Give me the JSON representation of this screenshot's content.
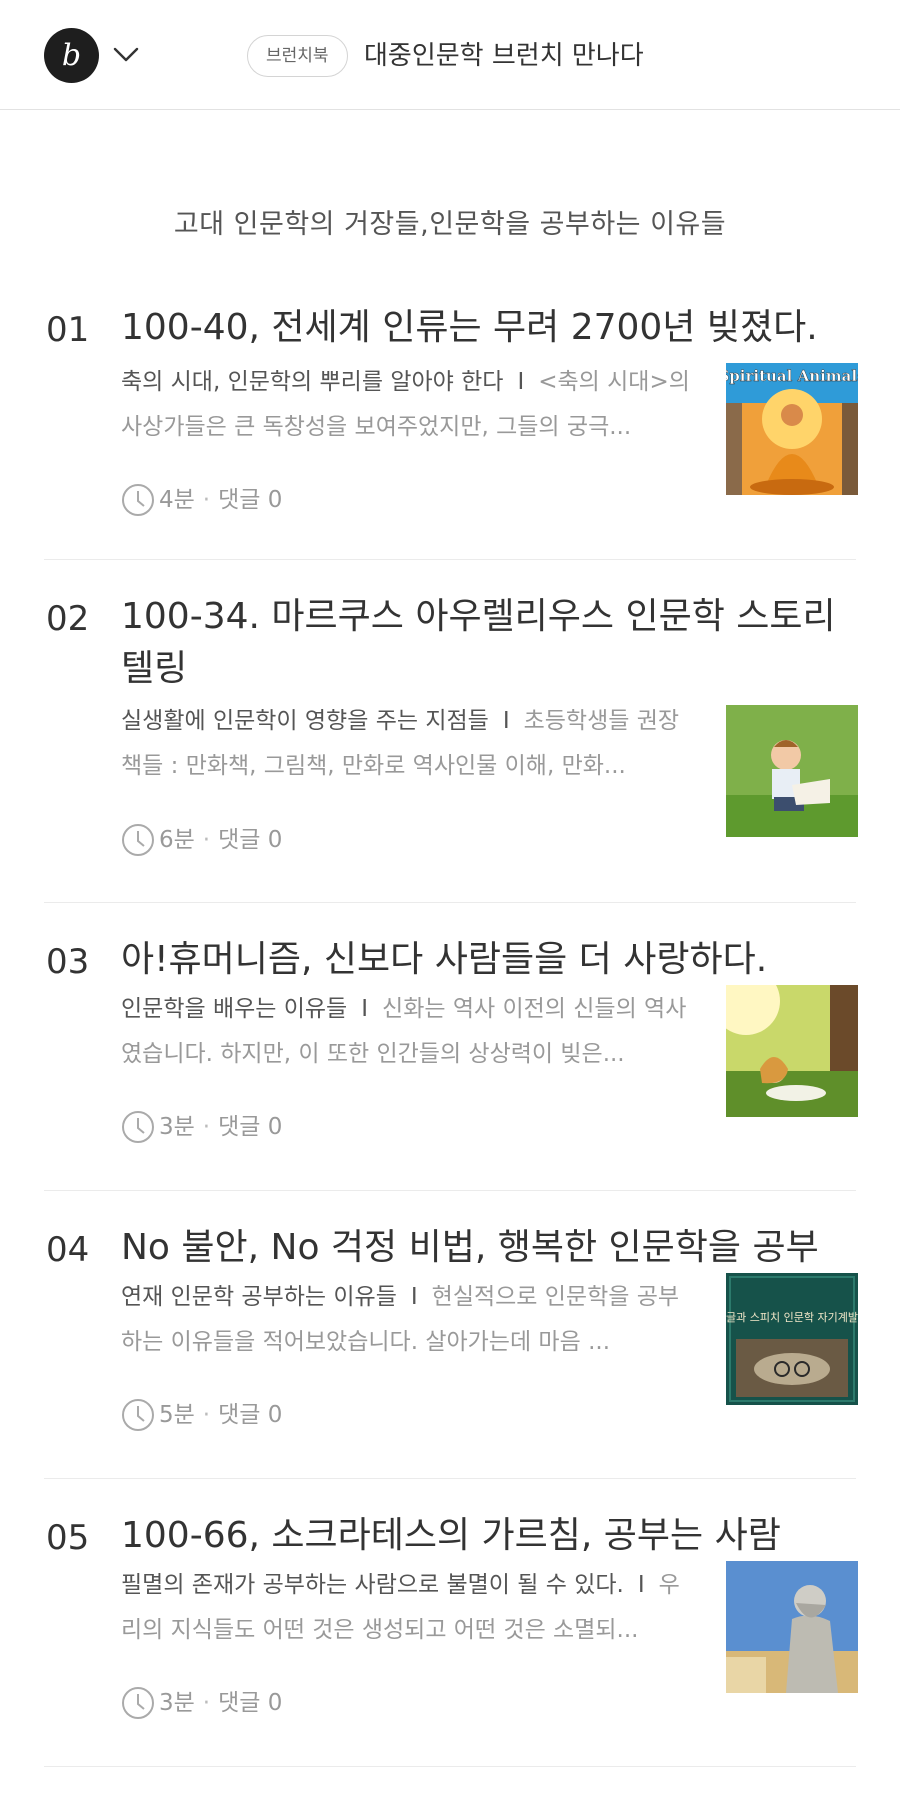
{
  "header": {
    "logo_letter": "b",
    "badge": "브런치북",
    "magazine_title": "대중인문학 브런치 만나다"
  },
  "subtitle": "고대 인문학의 거장들,인문학을 공부하는 이유들",
  "articles": [
    {
      "num": "01",
      "title": "100-40, 전세계 인류는 무려 2700년 빚졌다.",
      "keyword": "축의 시대, 인문학의 뿌리를 알아야 한다",
      "separator": "I",
      "excerpt": "<축의 시대>의 사상가들은 큰 독창성을 보여주었지만, 그들의 궁극...",
      "read_time": "4분",
      "comments": "댓글 0",
      "thumb_text": "Spiritual Animals"
    },
    {
      "num": "02",
      "title": "100-34. 마르쿠스 아우렐리우스 인문학 스토리텔링",
      "keyword": "실생활에 인문학이 영향을 주는 지점들",
      "separator": "I",
      "excerpt": "초등학생들 권장 책들 : 만화책, 그림책, 만화로 역사인물 이해, 만화...",
      "read_time": "6분",
      "comments": "댓글 0",
      "thumb_text": ""
    },
    {
      "num": "03",
      "title": "아!휴머니즘, 신보다 사람들을 더 사랑하다.",
      "keyword": "인문학을 배우는 이유들",
      "separator": "I",
      "excerpt": "신화는 역사 이전의 신들의 역사였습니다. 하지만, 이 또한 인간들의 상상력이 빚은...",
      "read_time": "3분",
      "comments": "댓글 0",
      "thumb_text": ""
    },
    {
      "num": "04",
      "title": "No 불안, No 걱정 비법, 행복한 인문학을 공부",
      "keyword": "연재 인문학 공부하는 이유들",
      "separator": "I",
      "excerpt": "현실적으로 인문학을 공부하는 이유들을 적어보았습니다. 살아가는데 마음 ...",
      "read_time": "5분",
      "comments": "댓글 0",
      "thumb_text": "글과 스피치 인문학 자기계발"
    },
    {
      "num": "05",
      "title": "100-66, 소크라테스의 가르침, 공부는 사람",
      "keyword": "필멸의 존재가 공부하는 사람으로 불멸이 될 수 있다.",
      "separator": "I",
      "excerpt": "우리의 지식들도 어떤 것은 생성되고 어떤 것은 소멸되...",
      "read_time": "3분",
      "comments": "댓글 0",
      "thumb_text": ""
    }
  ]
}
